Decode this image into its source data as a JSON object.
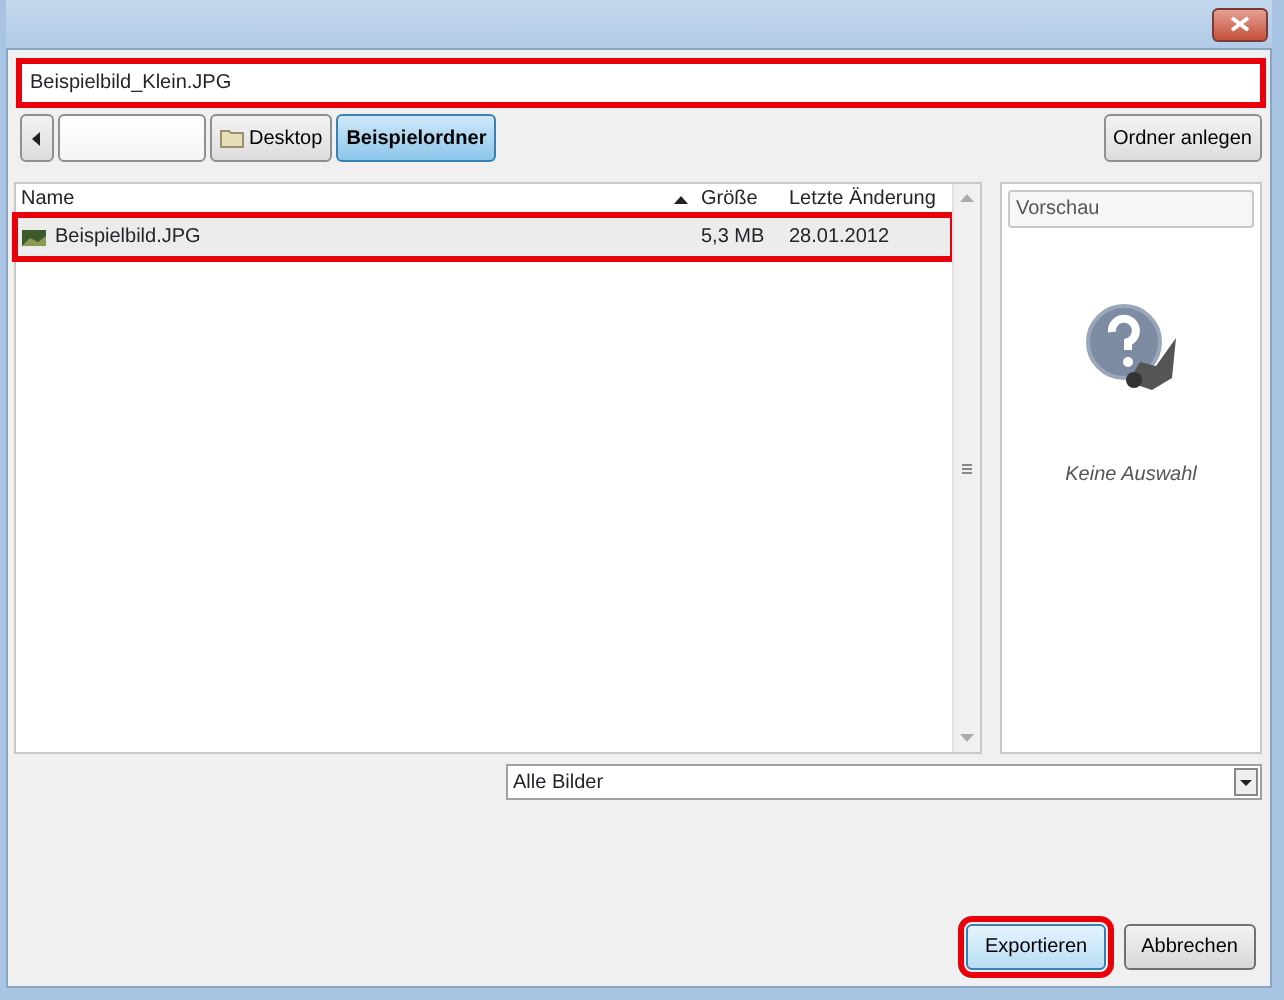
{
  "filename": {
    "value": "Beispielbild_Klein.JPG",
    "highlighted": true
  },
  "path_buttons": [
    {
      "kind": "blank",
      "selected": false
    },
    {
      "label": "Desktop",
      "kind": "folder",
      "selected": false
    },
    {
      "label": "Beispielordner",
      "kind": "plain",
      "selected": true
    }
  ],
  "create_folder_button": "Ordner anlegen",
  "file_table": {
    "columns": [
      "Name",
      "Größe",
      "Letzte Änderung"
    ],
    "rows": [
      {
        "name": "Beispielbild.JPG",
        "size": "5,3 MB",
        "modified": "28.01.2012",
        "selected": true,
        "highlighted": true
      }
    ]
  },
  "preview": {
    "title": "Vorschau",
    "message": "Keine Auswahl"
  },
  "filter": {
    "value": "Alle Bilder"
  },
  "buttons": [
    {
      "label": "Exportieren",
      "highlighted": true,
      "default": true
    },
    {
      "label": "Abbrechen",
      "highlighted": false,
      "default": false
    }
  ]
}
